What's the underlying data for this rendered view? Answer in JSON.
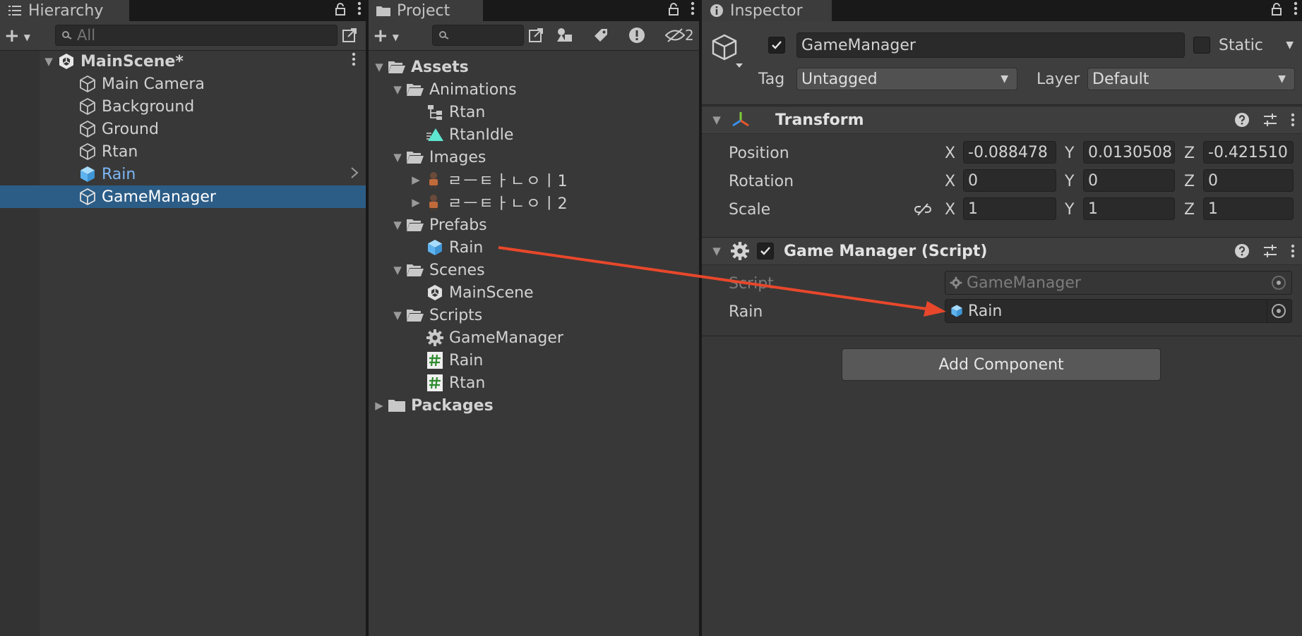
{
  "hierarchy": {
    "tab_label": "Hierarchy",
    "search_placeholder": "All",
    "scene_name": "MainScene*",
    "items": [
      {
        "label": "Main Camera"
      },
      {
        "label": "Background"
      },
      {
        "label": "Ground"
      },
      {
        "label": "Rtan"
      },
      {
        "label": "Rain"
      },
      {
        "label": "GameManager"
      }
    ]
  },
  "project": {
    "tab_label": "Project",
    "search_placeholder": "",
    "toolbar_count": "2",
    "tree": [
      {
        "label": "Assets",
        "bold": true
      },
      {
        "label": "Animations"
      },
      {
        "label": "Rtan"
      },
      {
        "label": "RtanIdle"
      },
      {
        "label": "Images"
      },
      {
        "label": "ㄹㅡㅌㅏㄴㅇㅣ1"
      },
      {
        "label": "ㄹㅡㅌㅏㄴㅇㅣ2"
      },
      {
        "label": "Prefabs"
      },
      {
        "label": "Rain"
      },
      {
        "label": "Scenes"
      },
      {
        "label": "MainScene"
      },
      {
        "label": "Scripts"
      },
      {
        "label": "GameManager"
      },
      {
        "label": "Rain"
      },
      {
        "label": "Rtan"
      },
      {
        "label": "Packages",
        "bold": true
      }
    ]
  },
  "inspector": {
    "tab_label": "Inspector",
    "object_name": "GameManager",
    "active": true,
    "static_label": "Static",
    "tag_label": "Tag",
    "tag_value": "Untagged",
    "layer_label": "Layer",
    "layer_value": "Default",
    "transform": {
      "title": "Transform",
      "position_label": "Position",
      "rotation_label": "Rotation",
      "scale_label": "Scale",
      "axis_x": "X",
      "axis_y": "Y",
      "axis_z": "Z",
      "position": {
        "x": "-0.088478",
        "y": "0.0130508",
        "z": "-0.421510"
      },
      "rotation": {
        "x": "0",
        "y": "0",
        "z": "0"
      },
      "scale": {
        "x": "1",
        "y": "1",
        "z": "1"
      }
    },
    "script_component": {
      "title": "Game Manager (Script)",
      "enabled": true,
      "script_label": "Script",
      "script_value": "GameManager",
      "rain_label": "Rain",
      "rain_value": "Rain"
    },
    "add_component_label": "Add Component"
  },
  "colors": {
    "background": "#383838",
    "selection": "#2c5d87",
    "prefab_blue": "#7cc4f4",
    "annotation_arrow": "#e8472b"
  }
}
